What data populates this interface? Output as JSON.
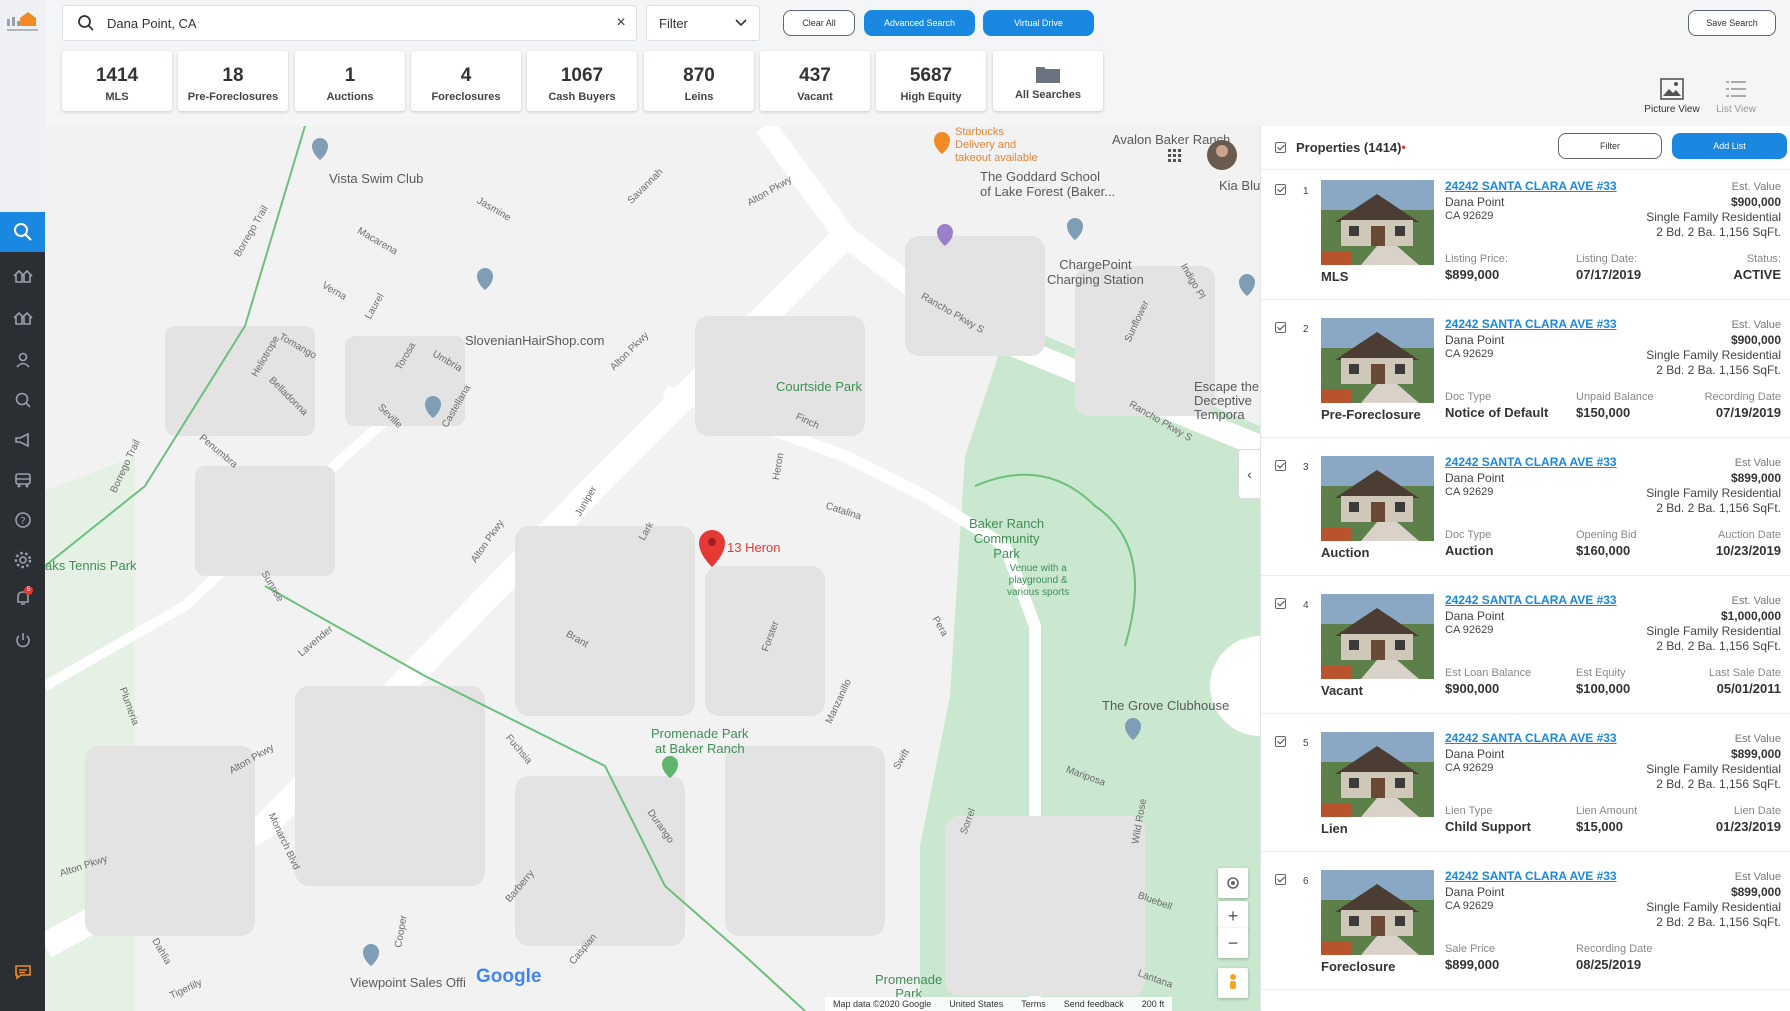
{
  "search": {
    "value": "Dana Point, CA",
    "clear": "×"
  },
  "filter": {
    "label": "Filter"
  },
  "toolbar": {
    "clear_all": "Clear All",
    "advanced_search": "Advanced Search",
    "virtual_drive": "Virtual Drive",
    "save_search": "Save Search"
  },
  "stats": [
    {
      "value": "1414",
      "label": "MLS"
    },
    {
      "value": "18",
      "label": "Pre-Foreclosures"
    },
    {
      "value": "1",
      "label": "Auctions"
    },
    {
      "value": "4",
      "label": "Foreclosures"
    },
    {
      "value": "1067",
      "label": "Cash Buyers"
    },
    {
      "value": "870",
      "label": "Leins"
    },
    {
      "value": "437",
      "label": "Vacant"
    },
    {
      "value": "5687",
      "label": "High Equity"
    },
    {
      "value": "",
      "label": "All Searches"
    }
  ],
  "views": {
    "picture": "Picture View",
    "list": "List View"
  },
  "map": {
    "labels": {
      "vista": "Vista Swim Club",
      "starbucks": "Starbucks\nDelivery and\ntakeout available",
      "goddard": "The Goddard School\nof Lake Forest (Baker...",
      "avalon": "Avalon Baker Ranch",
      "kia": "Kia Blu",
      "chargepoint": "ChargePoint\nCharging Station",
      "slovenian": "SlovenianHairShop.com",
      "courtside": "Courtside Park",
      "escape": "Escape the\nDeceptive\nTempora",
      "baker": "Baker Ranch\nCommunity\nPark",
      "baker_sub": "Venue with a\nplayground &\nvarious sports",
      "tennis": "aks Tennis Park",
      "heron": "13 Heron",
      "promenade": "Promenade Park\nat Baker Ranch",
      "grove": "The Grove Clubhouse",
      "viewpoint": "Viewpoint Sales Offi",
      "promenade2": "Promenade\nPark",
      "google": "Google"
    },
    "streets": {
      "alton1": "Alton Pkwy",
      "alton2": "Alton Pkwy",
      "alton3": "Alton Pkwy",
      "alton4": "Alton Pkwy",
      "alton5": "Alton Pkwy",
      "rancho1": "Rancho Pkwy S",
      "rancho2": "Rancho Pkwy S",
      "catalina": "Catalina",
      "borrego1": "Borrego Trail",
      "borrego2": "Borrego Trail",
      "jasmine": "Jasmine",
      "savannah": "Savannah",
      "macarena": "Macarena",
      "verna": "Verna",
      "laurel": "Laurel",
      "umbria": "Umbria",
      "tomango": "Tomango",
      "heliotrope": "Heliotrope",
      "belladonna": "Belladonna",
      "torosa": "Torosa",
      "seville": "Seville",
      "castellana": "Castellana",
      "penumbra": "Penumbra",
      "finch": "Finch",
      "heron_st": "Heron",
      "juniper": "Juniper",
      "lark": "Lark",
      "brant": "Brant",
      "forster": "Forster",
      "pera": "Pera",
      "manzanillo": "Manzanillo",
      "swift": "Swift",
      "sunrise": "Sunrise",
      "lavender": "Lavender",
      "fuchsia": "Fuchsia",
      "durango": "Durango",
      "barberry": "Barberry",
      "caspian": "Caspian",
      "sorrel": "Sorrel",
      "mariposa": "Mariposa",
      "wildrose": "Wild Rose",
      "bluebell": "Bluebell",
      "lantana": "Lantana",
      "plumeria": "Plumeria",
      "monarch": "Monarch Blvd",
      "dahlia": "Dahlia",
      "tigerlily": "Tigerlily",
      "cooper": "Cooper",
      "sunflower": "Sunflower",
      "indigo": "Indigo Pl"
    },
    "attribution": [
      "Map data ©2020 Google",
      "United States",
      "Terms",
      "Send feedback",
      "200 ft"
    ]
  },
  "panel": {
    "title": "Properties (1414)",
    "filter": "Filter",
    "add_list": "Add List",
    "items": [
      {
        "idx": "1",
        "type": "MLS",
        "address": "24242 SANTA CLARA AVE #33",
        "city": "Dana Point",
        "zip": "CA 92629",
        "ev_label": "Est. Value",
        "ev": "$900,000",
        "prop_type": "Single Family Residential",
        "beds": "2 Bd. 2 Ba. 1,156 SqFt.",
        "f1l": "Listing Price:",
        "f1v": "$899,000",
        "f2l": "Listing Date:",
        "f2v": "07/17/2019",
        "f3l": "Status:",
        "f3v": "ACTIVE"
      },
      {
        "idx": "2",
        "type": "Pre-Foreclosure",
        "address": "24242 SANTA CLARA AVE #33",
        "city": "Dana Point",
        "zip": "CA 92629",
        "ev_label": "Est. Value",
        "ev": "$900,000",
        "prop_type": "Single Family Residential",
        "beds": "2 Bd. 2 Ba. 1,156 SqFt.",
        "f1l": "Doc Type",
        "f1v": "Notice of Default",
        "f2l": "Unpaid Balance",
        "f2v": "$150,000",
        "f3l": "Recording Date",
        "f3v": "07/19/2019"
      },
      {
        "idx": "3",
        "type": "Auction",
        "address": "24242 SANTA CLARA AVE #33",
        "city": "Dana Point",
        "zip": "CA 92629",
        "ev_label": "Est Value",
        "ev": "$899,000",
        "prop_type": "Single Family Residential",
        "beds": "2 Bd. 2 Ba. 1,156 SqFt.",
        "f1l": "Doc Type",
        "f1v": "Auction",
        "f2l": "Opening Bid",
        "f2v": "$160,000",
        "f3l": "Auction Date",
        "f3v": "10/23/2019"
      },
      {
        "idx": "4",
        "type": "Vacant",
        "address": "24242 SANTA CLARA AVE #33",
        "city": "Dana Point",
        "zip": "CA 92629",
        "ev_label": "Est. Value",
        "ev": "$1,000,000",
        "prop_type": "Single Family Residential",
        "beds": "2 Bd. 2 Ba. 1,156 SqFt.",
        "f1l": "Est Loan Balance",
        "f1v": "$900,000",
        "f2l": "Est Equity",
        "f2v": "$100,000",
        "f3l": "Last Sale Date",
        "f3v": "05/01/2011"
      },
      {
        "idx": "5",
        "type": "Lien",
        "address": "24242 SANTA CLARA AVE #33",
        "city": "Dana Point",
        "zip": "CA 92629",
        "ev_label": "Est Value",
        "ev": "$899,000",
        "prop_type": "Single Family Residential",
        "beds": "2 Bd. 2 Ba. 1,156 SqFt.",
        "f1l": "Lien Type",
        "f1v": "Child Support",
        "f2l": "Lien Amount",
        "f2v": "$15,000",
        "f3l": "Lien Date",
        "f3v": "01/23/2019"
      },
      {
        "idx": "6",
        "type": "Foreclosure",
        "address": "24242 SANTA CLARA AVE #33",
        "city": "Dana Point",
        "zip": "CA 92629",
        "ev_label": "Est Value",
        "ev": "$899,000",
        "prop_type": "Single Family Residential",
        "beds": "2 Bd. 2 Ba. 1,156 SqFt.",
        "f1l": "Sale Price",
        "f1v": "$899,000",
        "f2l": "Recording Date",
        "f2v": "08/25/2019",
        "f3l": "",
        "f3v": ""
      }
    ]
  },
  "colors": {
    "accent": "#1a88e0",
    "rail": "#2b2e33",
    "park": "#c8e6c9",
    "pin": "#e53935"
  },
  "rail_notifications": "5"
}
